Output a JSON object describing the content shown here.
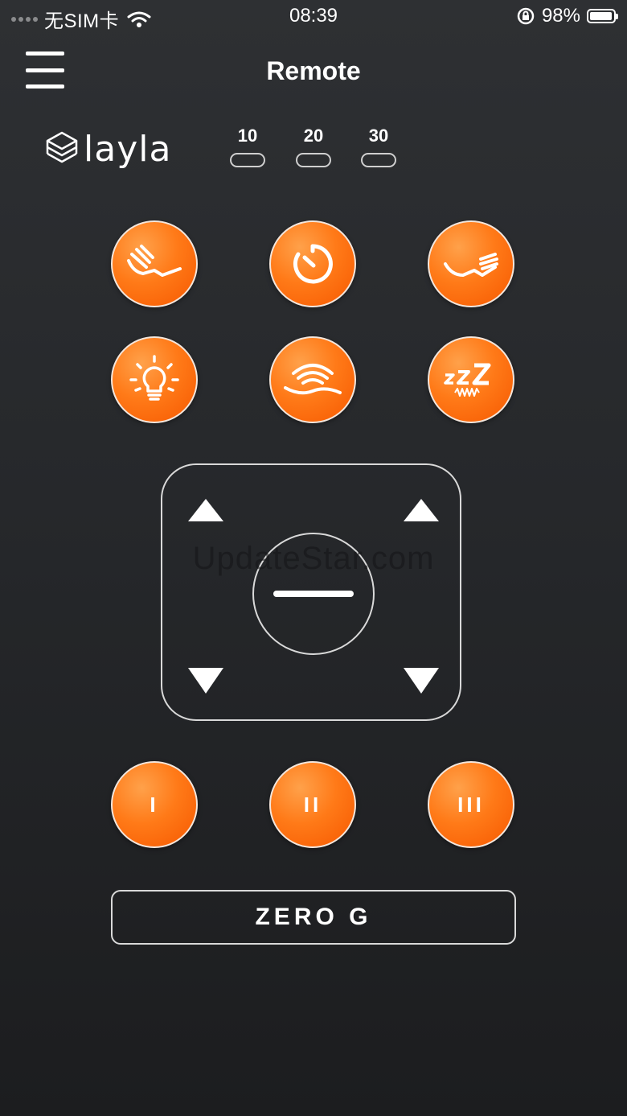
{
  "status_bar": {
    "carrier": "无SIM卡",
    "time": "08:39",
    "battery": "98%",
    "battery_level": 0.98
  },
  "nav": {
    "title": "Remote",
    "menu_icon": "hamburger-menu-icon"
  },
  "brand": {
    "name": "layla",
    "logo_icon": "stacked-layers-icon"
  },
  "timer": {
    "options": [
      "10",
      "20",
      "30"
    ]
  },
  "controls": {
    "row1": [
      "head-up-icon",
      "timer-icon",
      "foot-up-icon"
    ],
    "row2": [
      "light-bulb-icon",
      "massage-wave-icon",
      "sleep-zzz-icon"
    ],
    "dpad": [
      "head-up-arrow",
      "foot-up-arrow",
      "flat-button",
      "head-down-arrow",
      "foot-down-arrow"
    ],
    "massage_levels": [
      "I",
      "II",
      "III"
    ],
    "zero_g": "ZERO G"
  },
  "watermark": "UpdateStar.com",
  "colors": {
    "accent": "#ff7a18",
    "background": "#2a2c2f",
    "outline": "#d9d9d9"
  }
}
